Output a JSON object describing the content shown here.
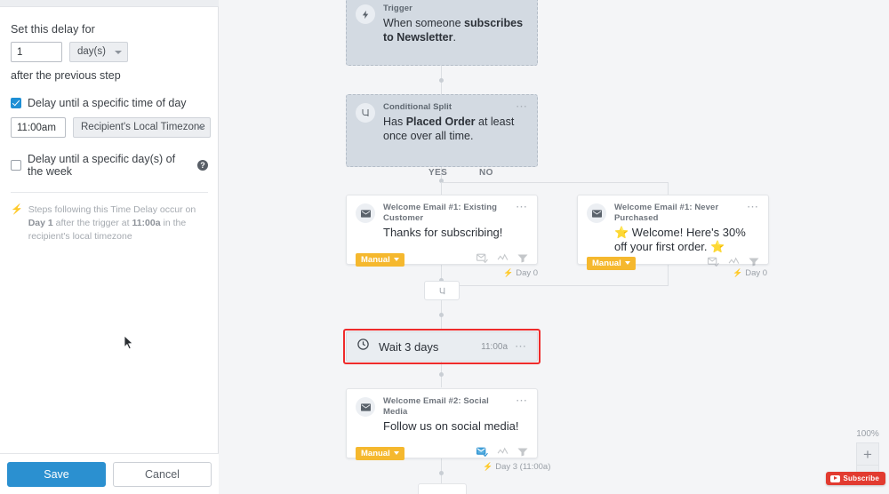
{
  "sidebar": {
    "delay_label": "Set this delay for",
    "delay_value": "1",
    "delay_unit": "day(s)",
    "after_step_label": "after the previous step",
    "specific_time_checkbox_label": "Delay until a specific time of day",
    "specific_time_checked": true,
    "time_value": "11:00am",
    "timezone_value": "Recipient's Local Timezone",
    "specific_days_checkbox_label": "Delay until a specific day(s) of the week",
    "specific_days_checked": false,
    "help_icon": "question-mark-icon",
    "note_prefix": "Steps following this Time Delay occur on ",
    "note_day": "Day 1",
    "note_middle": " after the trigger at ",
    "note_time": "11:00a",
    "note_suffix": " in the recipient's local timezone",
    "save_label": "Save",
    "cancel_label": "Cancel"
  },
  "flow": {
    "trigger": {
      "icon": "bolt-icon",
      "kicker": "Trigger",
      "headline_prefix": "When someone ",
      "headline_bold": "subscribes to Newsletter",
      "headline_suffix": "."
    },
    "conditional_split": {
      "icon": "split-icon",
      "kicker": "Conditional Split",
      "menu_icon": "ellipsis-icon",
      "headline_prefix": "Has ",
      "headline_bold": "Placed Order",
      "headline_suffix": " at least once over all time.",
      "branch_yes": "YES",
      "branch_no": "NO"
    },
    "email_existing": {
      "icon": "envelope-icon",
      "kicker": "Welcome Email #1: Existing Customer",
      "menu_icon": "ellipsis-icon",
      "headline": "Thanks for subscribing!",
      "pill": "Manual",
      "day_tag": "Day 0",
      "icons": [
        "envelope-check-icon",
        "analytics-icon",
        "filter-icon"
      ],
      "smart_sending_active": false
    },
    "email_never_purchased": {
      "icon": "envelope-icon",
      "kicker": "Welcome Email #1: Never Purchased",
      "menu_icon": "ellipsis-icon",
      "headline": "⭐ Welcome! Here's 30% off your first order. ⭐",
      "pill": "Manual",
      "day_tag": "Day 0",
      "icons": [
        "envelope-check-icon",
        "analytics-icon",
        "filter-icon"
      ],
      "smart_sending_active": false
    },
    "merge": {
      "icon": "merge-path-icon"
    },
    "wait": {
      "icon": "clock-icon",
      "title": "Wait 3 days",
      "time": "11:00a",
      "menu_icon": "ellipsis-icon",
      "selected": true,
      "selection_color": "#ef2b2b"
    },
    "email_social": {
      "icon": "envelope-icon",
      "kicker": "Welcome Email #2: Social Media",
      "menu_icon": "ellipsis-icon",
      "headline": "Follow us on social media!",
      "pill": "Manual",
      "day_tag": "Day 3 (11:00a)",
      "icons": [
        "envelope-check-icon",
        "analytics-icon",
        "filter-icon"
      ],
      "smart_sending_active": true
    }
  },
  "zoom_controls": {
    "percent": "100%",
    "zoom_in_label": "+",
    "zoom_in_icon": "plus-icon",
    "zoom_out_icon": "minus-icon"
  },
  "watermark": {
    "label": "Subscribe",
    "icon": "youtube-icon"
  },
  "colors": {
    "accent_blue": "#2b90d0",
    "pill_yellow": "#f5b82e",
    "selection_red": "#ef2b2b",
    "canvas_bg": "#f4f5f7",
    "grey_card": "#d3dae2"
  }
}
